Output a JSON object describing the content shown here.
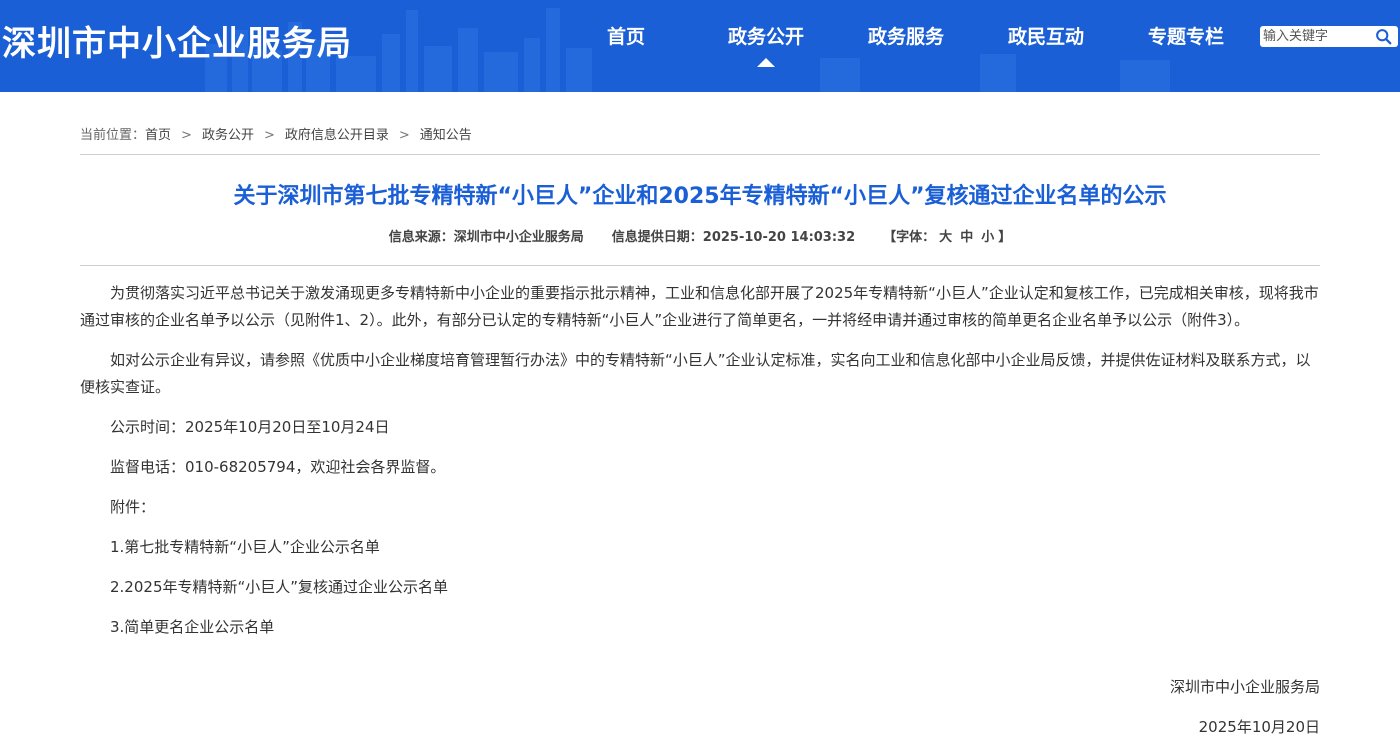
{
  "header": {
    "site_title": "深圳市中小企业服务局",
    "nav": [
      "首页",
      "政务公开",
      "政务服务",
      "政民互动",
      "专题专栏"
    ],
    "active_nav": "政务公开",
    "search": {
      "placeholder": "输入关键字"
    }
  },
  "breadcrumb": {
    "prefix": "当前位置：",
    "items": [
      "首页",
      "政务公开",
      "政府信息公开目录",
      "通知公告"
    ],
    "separator": ">"
  },
  "article": {
    "title": "关于深圳市第七批专精特新“小巨人”企业和2025年专精特新“小巨人”复核通过企业名单的公示",
    "source_label": "信息来源：",
    "source": "深圳市中小企业服务局",
    "date_label": "信息提供日期：",
    "date": "2025-10-20 14:03:32",
    "font_open": "【字体：",
    "font_large": "大",
    "font_medium": "中",
    "font_small": "小",
    "font_close": "】",
    "paragraphs": [
      "为贯彻落实习近平总书记关于激发涌现更多专精特新中小企业的重要指示批示精神，工业和信息化部开展了2025年专精特新“小巨人”企业认定和复核工作，已完成相关审核，现将我市通过审核的企业名单予以公示（见附件1、2）。此外，有部分已认定的专精特新“小巨人”企业进行了简单更名，一并将经申请并通过审核的简单更名企业名单予以公示（附件3）。",
      "如对公示企业有异议，请参照《优质中小企业梯度培育管理暂行办法》中的专精特新“小巨人”企业认定标准，实名向工业和信息化部中小企业局反馈，并提供佐证材料及联系方式，以便核实查证。",
      "公示时间：2025年10月20日至10月24日",
      "监督电话：010-68205794，欢迎社会各界监督。",
      "附件："
    ],
    "attachments": [
      "1.第七批专精特新“小巨人”企业公示名单",
      "2.2025年专精特新“小巨人”复核通过企业公示名单",
      "3.简单更名企业公示名单"
    ],
    "signature": "深圳市中小企业服务局",
    "sign_date": "2025年10月20日"
  },
  "colors": {
    "header_blue": "#1a5fd6",
    "title_blue": "#1a5fd6",
    "text": "#333333"
  }
}
